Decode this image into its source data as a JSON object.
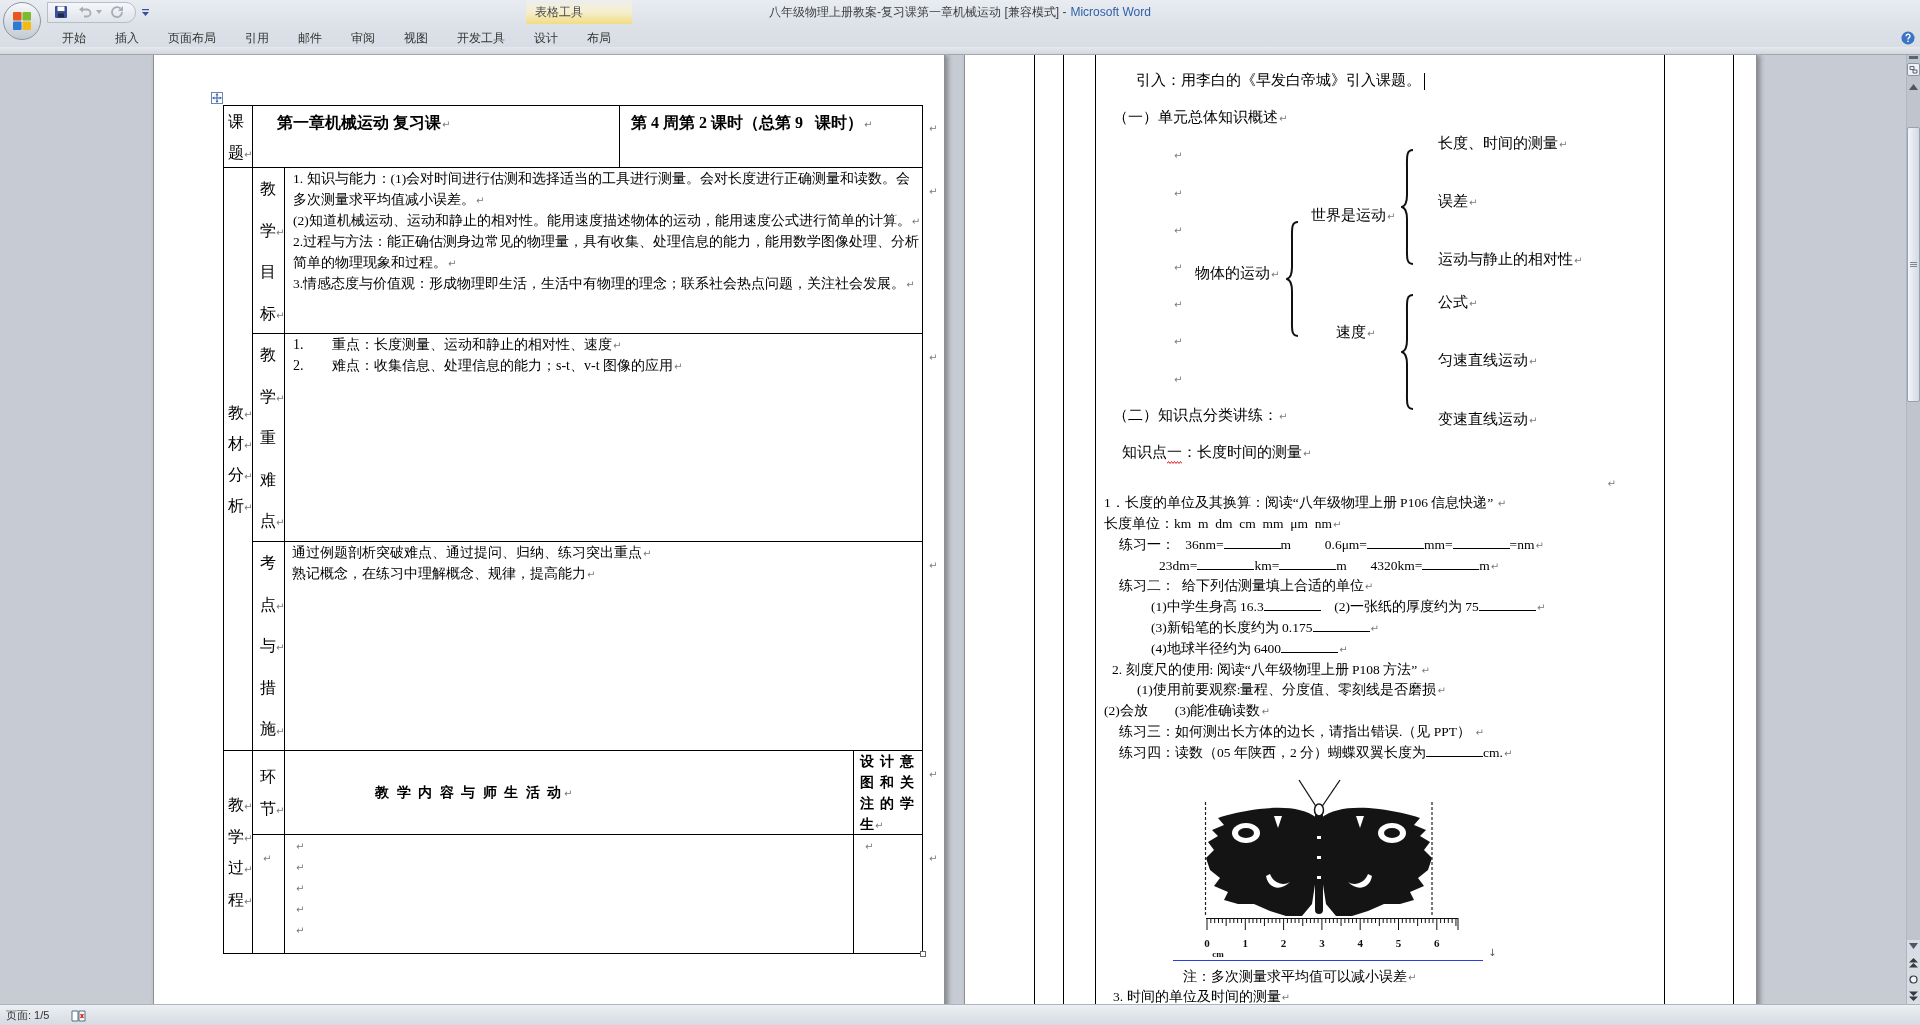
{
  "window": {
    "document_title": "八年级物理上册教案-复习课第一章机械运动 [兼容模式] -",
    "app_name": "Microsoft Word"
  },
  "quick_access": [
    {
      "kind": "save",
      "disabled": false
    },
    {
      "kind": "undo",
      "disabled": true
    },
    {
      "kind": "menu",
      "disabled": true
    },
    {
      "kind": "redo",
      "disabled": true
    },
    {
      "kind": "customize",
      "disabled": false
    }
  ],
  "contextual_group": {
    "label": "表格工具",
    "tabs": [
      {
        "label": "设计",
        "selected": false
      },
      {
        "label": "布局",
        "selected": false
      }
    ]
  },
  "ribbon_tabs": [
    {
      "label": "开始",
      "selected": false
    },
    {
      "label": "插入",
      "selected": false
    },
    {
      "label": "页面布局",
      "selected": false
    },
    {
      "label": "引用",
      "selected": false
    },
    {
      "label": "邮件",
      "selected": false
    },
    {
      "label": "审阅",
      "selected": false
    },
    {
      "label": "视图",
      "selected": false
    },
    {
      "label": "开发工具",
      "selected": false
    }
  ],
  "left_page": {
    "table": {
      "title_label": [
        {
          "text": "课题",
          "mark": "↵"
        }
      ],
      "title": {
        "text": "第一章机械运动 复习课",
        "mark": "↵"
      },
      "schedule": {
        "text": "第 4 周第 2 课时（总第 9   课时）",
        "mark": "↵"
      },
      "analysis_label": [
        {
          "text": "教",
          "mark": "↵"
        },
        {
          "text": "材",
          "mark": "↵"
        },
        {
          "text": "分",
          "mark": "↵"
        },
        {
          "text": "析",
          "mark": "↵"
        }
      ],
      "analysis_rows": [
        {
          "label": [
            {
              "text": "教学",
              "mark": "↵"
            },
            {
              "text": "目标",
              "mark": "↵"
            }
          ],
          "content": [
            {
              "text": "1. 知识与能力：(1)会对时间进行估测和选择适当的工具进行测量。会对长度进行正确测量和读数。会多次测量求平均值减小误差。",
              "mark": "↵"
            },
            {
              "text": "  (2)知道机械运动、运动和静止的相对性。能用速度描述物体的运动，能用速度公式进行简单的计算。",
              "mark": "↵"
            },
            {
              "text": "2.过程与方法：能正确估测身边常见的物理量，具有收集、处理信息的能力，能用数学图像处理、分析简单的物理现象和过程。",
              "mark": "↵"
            },
            {
              "text": "3.情感态度与价值观：形成物理即生活，生活中有物理的理念；联系社会热点问题，关注社会发展。",
              "mark": "↵"
            }
          ]
        },
        {
          "label": [
            {
              "text": "教学",
              "mark": "↵"
            },
            {
              "text": "重难点",
              "mark": "↵"
            }
          ],
          "content": [
            {
              "number": "1.",
              "text": "重点：长度测量、运动和静止的相对性、速度",
              "mark": "↵"
            },
            {
              "number": "2.",
              "text": "难点：收集信息、处理信息的能力；s-t、v-t 图像的应用",
              "mark": "↵"
            }
          ]
        },
        {
          "label": [
            {
              "text": "考点",
              "mark": "↵"
            },
            {
              "text": "与",
              "mark": "↵"
            },
            {
              "text": "措施",
              "mark": "↵"
            }
          ],
          "content": [
            {
              "text": "通过例题剖析突破难点、通过提问、归纳、练习突出重点",
              "mark": "↵"
            },
            {
              "text": "熟记概念，在练习中理解概念、规律，提高能力",
              "mark": "↵"
            }
          ]
        }
      ],
      "process_label": [
        {
          "text": "教",
          "mark": "↵"
        },
        {
          "text": "学",
          "mark": "↵"
        },
        {
          "text": "过",
          "mark": "↵"
        },
        {
          "text": "程",
          "mark": "↵"
        }
      ],
      "process_header": {
        "stage": [
          {
            "text": "环节",
            "mark": "↵"
          }
        ],
        "activity": {
          "text": "教 学 内 容 与 师 生 活 动",
          "mark": "↵"
        },
        "design": {
          "text": "设计意图和关注的学生",
          "mark": "↵"
        }
      },
      "process_body": {
        "stage": [
          {
            "mark": "↵"
          }
        ],
        "activity": [
          {
            "mark": "↵"
          },
          {
            "mark": "↵"
          },
          {
            "mark": "↵"
          },
          {
            "mark": "↵"
          },
          {
            "mark": "↵"
          }
        ],
        "design": [
          {
            "mark": "↵"
          }
        ]
      },
      "row_end_marks": [
        "↵",
        "↵",
        "↵",
        "↵",
        "↵",
        "↵"
      ]
    }
  },
  "right_page": {
    "intro": {
      "text": "引入：用李白的《早发白帝城》引入课题。"
    },
    "overview_heading": {
      "text": "（一）单元总体知识概述",
      "mark": "↵"
    },
    "overview_blank_lines": [
      {
        "mark": "↵"
      },
      {
        "mark": "↵"
      },
      {
        "mark": "↵"
      },
      {
        "mark": "↵"
      },
      {
        "mark": "↵"
      },
      {
        "mark": "↵"
      },
      {
        "mark": "↵"
      }
    ],
    "concept_map": {
      "root": {
        "text": "物体的运动",
        "mark": "↵"
      },
      "branches": [
        {
          "text": "世界是运动",
          "mark": "↵",
          "children": [
            {
              "text": "长度、时间的测量",
              "mark": "↵"
            },
            {
              "text": "误差",
              "mark": "↵"
            },
            {
              "text": "运动与静止的相对性",
              "mark": "↵"
            }
          ]
        },
        {
          "text": "速度",
          "mark": "↵",
          "children": [
            {
              "text": "公式",
              "mark": "↵"
            },
            {
              "text": "匀速直线运动",
              "mark": "↵"
            },
            {
              "text": "变速直线运动",
              "mark": "↵"
            }
          ]
        }
      ]
    },
    "practice_heading": {
      "text": "（二）知识点分类讲练：",
      "mark": "↵"
    },
    "knowledge_point": {
      "text": "知识点一：长度时间的测量",
      "mark": "↵",
      "spell_error": true
    },
    "right_mark": {
      "mark": "↵"
    },
    "lines": [
      {
        "parts": [
          {
            "kind": "text",
            "text": "1．长度的单位及其换算：阅读“八年级物理上册 P106 信息快递” "
          }
        ],
        "mark": "↵"
      },
      {
        "parts": [
          {
            "kind": "text",
            "text": "长度单位：km  m  dm  cm  mm  μm  nm"
          }
        ],
        "mark": "↵"
      },
      {
        "parts": [
          {
            "kind": "text",
            "text": "练习一：   36nm="
          },
          {
            "kind": "blank"
          },
          {
            "kind": "text",
            "text": "m          0.6μm="
          },
          {
            "kind": "blank"
          },
          {
            "kind": "text",
            "text": "mm="
          },
          {
            "kind": "blank"
          },
          {
            "kind": "text",
            "text": "=nm"
          }
        ],
        "mark": "↵"
      },
      {
        "parts": [
          {
            "kind": "text",
            "text": "23dm="
          },
          {
            "kind": "blank"
          },
          {
            "kind": "text",
            "text": "km="
          },
          {
            "kind": "blank"
          },
          {
            "kind": "text",
            "text": "m       4320km="
          },
          {
            "kind": "blank"
          },
          {
            "kind": "text",
            "text": "m"
          }
        ],
        "mark": "↵"
      },
      {
        "parts": [
          {
            "kind": "text",
            "text": "练习二：  给下列估测量填上合适的单位"
          }
        ],
        "mark": "↵"
      },
      {
        "parts": [
          {
            "kind": "text",
            "text": "(1)中学生身高 16.3"
          },
          {
            "kind": "blank"
          },
          {
            "kind": "text",
            "text": "    (2)一张纸的厚度约为 75"
          },
          {
            "kind": "blank"
          }
        ],
        "mark": "↵"
      },
      {
        "parts": [
          {
            "kind": "text",
            "text": "(3)新铅笔的长度约为 0.175"
          },
          {
            "kind": "blank"
          }
        ],
        "mark": "↵"
      },
      {
        "parts": [
          {
            "kind": "text",
            "text": "(4)地球半径约为 6400"
          },
          {
            "kind": "blank"
          }
        ],
        "mark": "↵"
      },
      {
        "parts": [
          {
            "kind": "text",
            "text": "2. 刻度尺的使用: 阅读“八年级物理上册 P108 方法” "
          }
        ],
        "mark": "↵"
      },
      {
        "parts": [
          {
            "kind": "text",
            "text": "(1)使用前要观察:量程、分度值、零刻线是否磨损"
          }
        ],
        "mark": "↵"
      },
      {
        "parts": [
          {
            "kind": "text",
            "text": "(2)会放        (3)能准确读数"
          }
        ],
        "mark": "↵"
      },
      {
        "parts": [
          {
            "kind": "text",
            "text": "练习三：如何测出长方体的边长，请指出错误.（见 PPT） "
          }
        ],
        "mark": "↵"
      },
      {
        "parts": [
          {
            "kind": "text",
            "text": "练习四：读数（05 年陕西，2 分）蝴蝶双翼长度为"
          },
          {
            "kind": "blank"
          },
          {
            "kind": "text",
            "text": "cm."
          }
        ],
        "mark": "↵"
      }
    ],
    "figure": {
      "ruler_labels": [
        "0",
        "1",
        "2",
        "3",
        "4",
        "5",
        "6"
      ],
      "unit": "cm",
      "break_mark": "↓"
    },
    "note": {
      "text": "注：多次测量求平均值可以减小误差",
      "mark": "↵"
    },
    "next_heading": {
      "text": "3. 时间的单位及时间的测量",
      "mark": "↵"
    }
  },
  "status_bar": {
    "page_info": "页面: 1/5"
  }
}
